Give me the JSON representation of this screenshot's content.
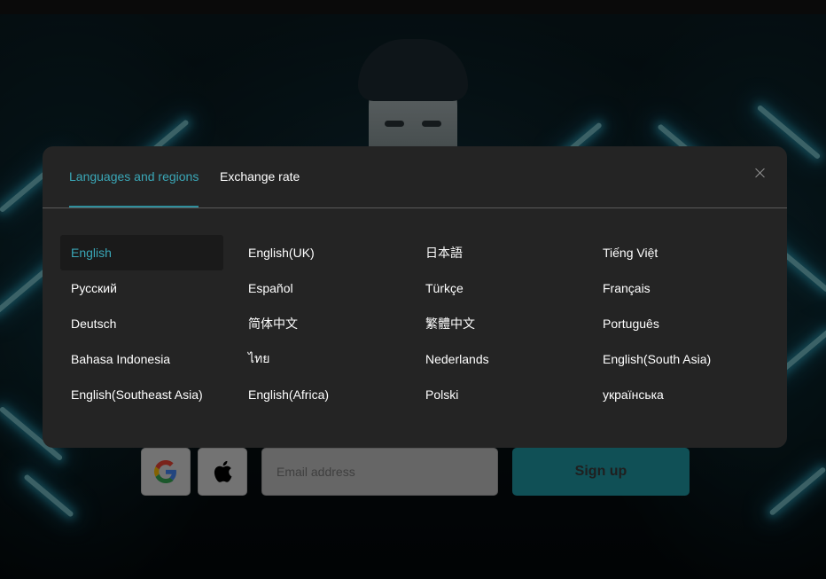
{
  "modal": {
    "tabs": [
      {
        "label": "Languages and regions",
        "active": true
      },
      {
        "label": "Exchange rate",
        "active": false
      }
    ],
    "close_icon": "close-icon",
    "selected_language": "English",
    "languages": [
      "English",
      "English(UK)",
      "日本語",
      "Tiếng Việt",
      "Русский",
      "Español",
      "Türkçe",
      "Français",
      "Deutsch",
      "简体中文",
      "繁體中文",
      "Português",
      "Bahasa Indonesia",
      "ไทย",
      "Nederlands",
      "English(South Asia)",
      "English(Southeast Asia)",
      "English(Africa)",
      "Polski",
      "українська"
    ]
  },
  "signup": {
    "google_icon": "google-icon",
    "apple_icon": "apple-icon",
    "email_placeholder": "Email address",
    "signup_label": "Sign up"
  },
  "colors": {
    "accent": "#3aa7b7",
    "modal_bg": "#242424",
    "signup_button": "#1f99a6"
  }
}
